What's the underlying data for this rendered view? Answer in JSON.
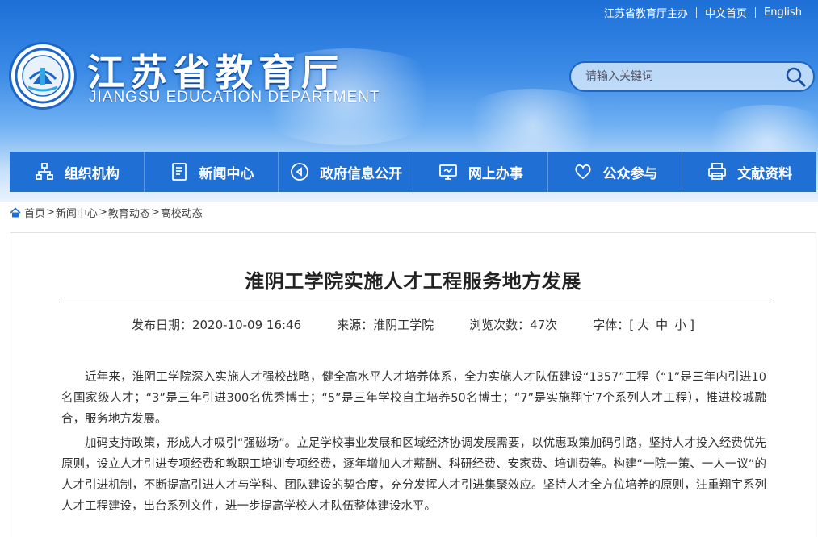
{
  "header": {
    "top_links": [
      "江苏省教育厅主办",
      "中文首页",
      "English"
    ],
    "logo_cn": "江苏省教育厅",
    "logo_en": "JIANGSU EDUCATION DEPARTMENT",
    "search_placeholder": "请输入关键词"
  },
  "nav": {
    "items": [
      {
        "label": "组织机构",
        "icon": "org-chart-icon"
      },
      {
        "label": "新闻中心",
        "icon": "document-icon"
      },
      {
        "label": "政府信息公开",
        "icon": "megaphone-icon"
      },
      {
        "label": "网上办事",
        "icon": "monitor-icon"
      },
      {
        "label": "公众参与",
        "icon": "heart-icon"
      },
      {
        "label": "文献资料",
        "icon": "printer-icon"
      }
    ]
  },
  "breadcrumb": [
    "首页",
    "新闻中心",
    "教育动态",
    "高校动态"
  ],
  "article": {
    "title": "淮阴工学院实施人才工程服务地方发展",
    "publish_date": "发布日期：2020-10-09 16:46",
    "source": "来源：淮阴工学院",
    "views": "浏览次数：47次",
    "font_label": "字体：[",
    "font_large": "大",
    "font_medium": "中",
    "font_small": "小",
    "font_close": "]",
    "paragraphs": [
      "近年来，淮阴工学院深入实施人才强校战略，健全高水平人才培养体系，全力实施人才队伍建设“1357”工程（“1”是三年内引进10名国家级人才；“3”是三年引进300名优秀博士；“5”是三年学校自主培养50名博士；“7”是实施翔宇7个系列人才工程），推进校城融合，服务地方发展。",
      "加码支持政策，形成人才吸引“强磁场”。立足学校事业发展和区域经济协调发展需要，以优惠政策加码引路，坚持人才投入经费优先原则，设立人才引进专项经费和教职工培训专项经费，逐年增加人才薪酬、科研经费、安家费、培训费等。构建“一院一策、一人一议”的人才引进机制，不断提高引进人才与学科、团队建设的契合度，充分发挥人才引进集聚效应。坚持人才全方位培养的原则，注重翔宇系列人才工程建设，出台系列文件，进一步提高学校人才队伍整体建设水平。"
    ]
  },
  "colors": {
    "nav_bg": "#1f6fd4",
    "header_blue": "#1d6fd6"
  }
}
